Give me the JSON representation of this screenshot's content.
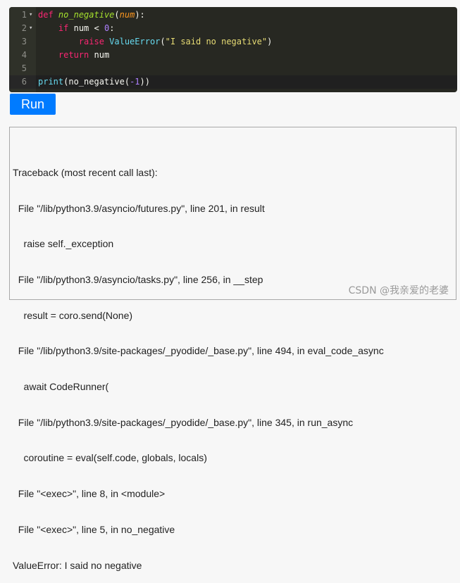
{
  "editor": {
    "lines": [
      {
        "n": "1",
        "fold": true
      },
      {
        "n": "2",
        "fold": true
      },
      {
        "n": "3",
        "fold": false
      },
      {
        "n": "4",
        "fold": false
      },
      {
        "n": "5",
        "fold": false
      },
      {
        "n": "6",
        "fold": false
      }
    ],
    "code": {
      "l1_def": "def",
      "l1_name": "no_negative",
      "l1_open": "(",
      "l1_param": "num",
      "l1_close": "):",
      "l2_if": "if",
      "l2_var": "num",
      "l2_op": " < ",
      "l2_num": "0",
      "l2_colon": ":",
      "l3_raise": "raise",
      "l3_cls": "ValueError",
      "l3_open": "(",
      "l3_str": "\"I said no negative\"",
      "l3_close": ")",
      "l4_return": "return",
      "l4_var": "num",
      "l6_print": "print",
      "l6_open": "(",
      "l6_call": "no_negative",
      "l6_open2": "(",
      "l6_arg": "-1",
      "l6_close": "))"
    }
  },
  "run_button": {
    "label": "Run"
  },
  "output": {
    "lines": [
      "Traceback (most recent call last):",
      "  File \"/lib/python3.9/asyncio/futures.py\", line 201, in result",
      "    raise self._exception",
      "  File \"/lib/python3.9/asyncio/tasks.py\", line 256, in __step",
      "    result = coro.send(None)",
      "  File \"/lib/python3.9/site-packages/_pyodide/_base.py\", line 494, in eval_code_async",
      "    await CodeRunner(",
      "  File \"/lib/python3.9/site-packages/_pyodide/_base.py\", line 345, in run_async",
      "    coroutine = eval(self.code, globals, locals)",
      "  File \"<exec>\", line 8, in <module>",
      "  File \"<exec>\", line 5, in no_negative",
      "ValueError: I said no negative"
    ]
  },
  "watermark": "CSDN @我亲爱的老婆",
  "colors": {
    "editor_bg": "#272822",
    "run_button_bg": "#007bff",
    "keyword": "#f92672",
    "function": "#a6e22e",
    "string": "#e6db74",
    "number": "#ae81ff",
    "builtin": "#66d9ef"
  }
}
